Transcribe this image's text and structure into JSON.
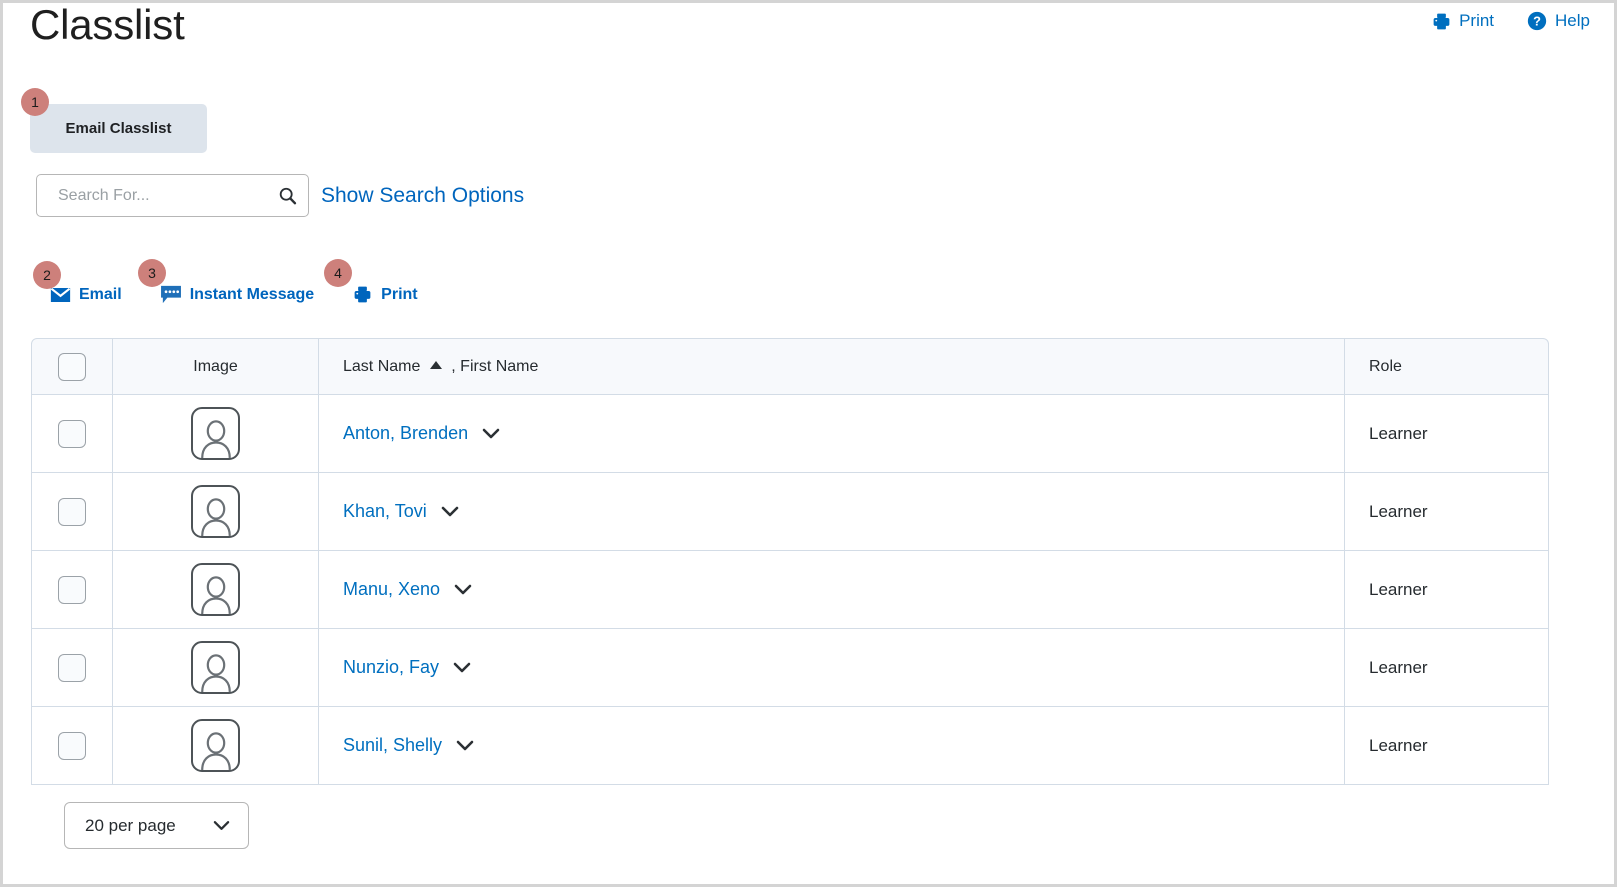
{
  "header": {
    "title": "Classlist",
    "print_label": "Print",
    "print_icon": "printer-icon",
    "help_label": "Help",
    "help_icon": "help-circle-icon"
  },
  "toolbar": {
    "email_classlist_label": "Email Classlist"
  },
  "search": {
    "placeholder": "Search For...",
    "value": "",
    "icon": "search-icon",
    "show_options_label": "Show Search Options"
  },
  "actions": [
    {
      "label": "Email",
      "icon": "envelope-icon"
    },
    {
      "label": "Instant Message",
      "icon": "chat-bubble-icon"
    },
    {
      "label": "Print",
      "icon": "printer-icon"
    }
  ],
  "callouts": [
    {
      "number": "1"
    },
    {
      "number": "2"
    },
    {
      "number": "3"
    },
    {
      "number": "4"
    }
  ],
  "table": {
    "columns": {
      "image": "Image",
      "name_last": "Last Name",
      "name_first": ", First Name",
      "role": "Role"
    },
    "sort": {
      "column": "Last Name",
      "direction": "ascending"
    },
    "rows": [
      {
        "name": "Anton, Brenden",
        "role": "Learner",
        "avatar": "user-avatar-placeholder-icon"
      },
      {
        "name": "Khan, Tovi",
        "role": "Learner",
        "avatar": "user-avatar-placeholder-icon"
      },
      {
        "name": "Manu, Xeno",
        "role": "Learner",
        "avatar": "user-avatar-placeholder-icon"
      },
      {
        "name": "Nunzio, Fay",
        "role": "Learner",
        "avatar": "user-avatar-placeholder-icon"
      },
      {
        "name": "Sunil, Shelly",
        "role": "Learner",
        "avatar": "user-avatar-placeholder-icon"
      }
    ]
  },
  "pagination": {
    "per_page_label": "20 per page"
  },
  "colors": {
    "link_blue": "#006fbf",
    "action_blue": "#0065bd",
    "callout_rose": "#cd807b",
    "button_bg": "#dde4ec",
    "table_header_bg": "#f7f9fc",
    "table_border": "#d3dce6"
  }
}
